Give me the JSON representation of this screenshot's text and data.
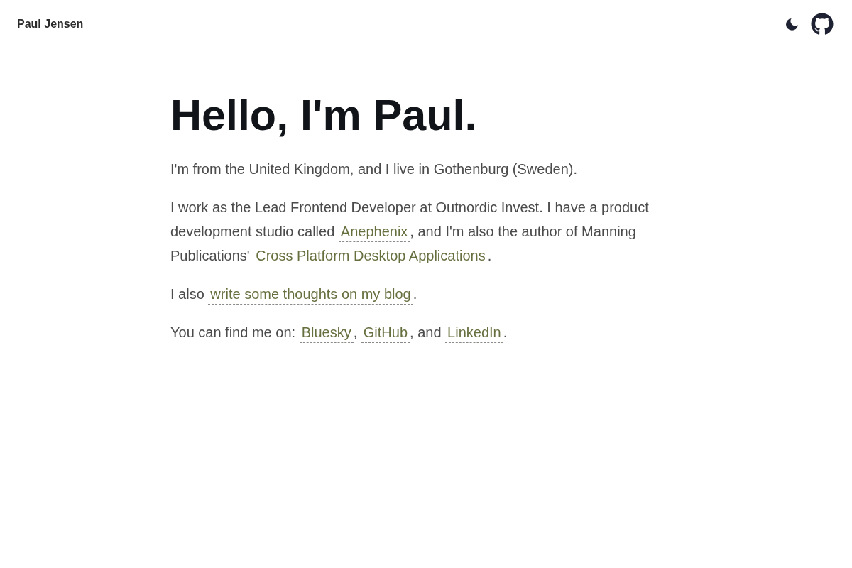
{
  "header": {
    "name": "Paul Jensen"
  },
  "heading": "Hello, I'm Paul.",
  "paragraphs": [
    {
      "segments": [
        {
          "kind": "text",
          "text": "I'm from the United Kingdom, and I live in Gothenburg (Sweden)."
        }
      ]
    },
    {
      "segments": [
        {
          "kind": "text",
          "text": "I work as the Lead Frontend Developer at Outnordic Invest. I have a product development studio called "
        },
        {
          "kind": "link",
          "text": "Anephenix"
        },
        {
          "kind": "text",
          "text": ", and I'm also the author of Manning Publications' "
        },
        {
          "kind": "link",
          "text": "Cross Platform Desktop Applications"
        },
        {
          "kind": "text",
          "text": "."
        }
      ]
    },
    {
      "segments": [
        {
          "kind": "text",
          "text": "I also "
        },
        {
          "kind": "link",
          "text": "write some thoughts on my blog"
        },
        {
          "kind": "text",
          "text": "."
        }
      ]
    },
    {
      "segments": [
        {
          "kind": "text",
          "text": "You can find me on: "
        },
        {
          "kind": "link",
          "text": "Bluesky"
        },
        {
          "kind": "text",
          "text": ", "
        },
        {
          "kind": "link",
          "text": "GitHub"
        },
        {
          "kind": "text",
          "text": ", and "
        },
        {
          "kind": "link",
          "text": "LinkedIn"
        },
        {
          "kind": "text",
          "text": "."
        }
      ]
    }
  ]
}
